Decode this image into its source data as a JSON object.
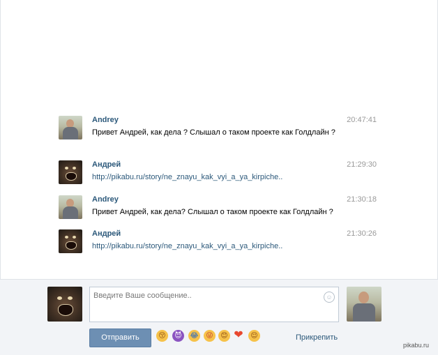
{
  "messages": [
    {
      "sender": "Andrey",
      "time": "20:47:41",
      "text": "Привет Андрей, как дела ? Слышал о таком проекте как Голдлайн ?",
      "avatar": "person-avatar"
    },
    {
      "sender": "Андрей",
      "time": "21:29:30",
      "text": "http://pikabu.ru/story/ne_znayu_kak_vyi_a_ya_kirpiche..",
      "avatar": "monster-avatar"
    },
    {
      "sender": "Andrey",
      "time": "21:30:18",
      "text": "Привет Андрей, как дела? Слышал о таком проекте как Голдлайн ?",
      "avatar": "person-avatar"
    },
    {
      "sender": "Андрей",
      "time": "21:30:26",
      "text": "http://pikabu.ru/story/ne_znayu_kak_vyi_a_ya_kirpiche..",
      "avatar": "monster-avatar"
    }
  ],
  "compose": {
    "placeholder": "Введите Ваше сообщение..",
    "send_label": "Отправить",
    "attach_label": "Прикрепить",
    "emojis": [
      "kissing-face",
      "smiling-devil",
      "laughing-face",
      "winking-tongue",
      "smiling-face",
      "heart",
      "relieved-face"
    ]
  },
  "watermark": "pikabu.ru"
}
